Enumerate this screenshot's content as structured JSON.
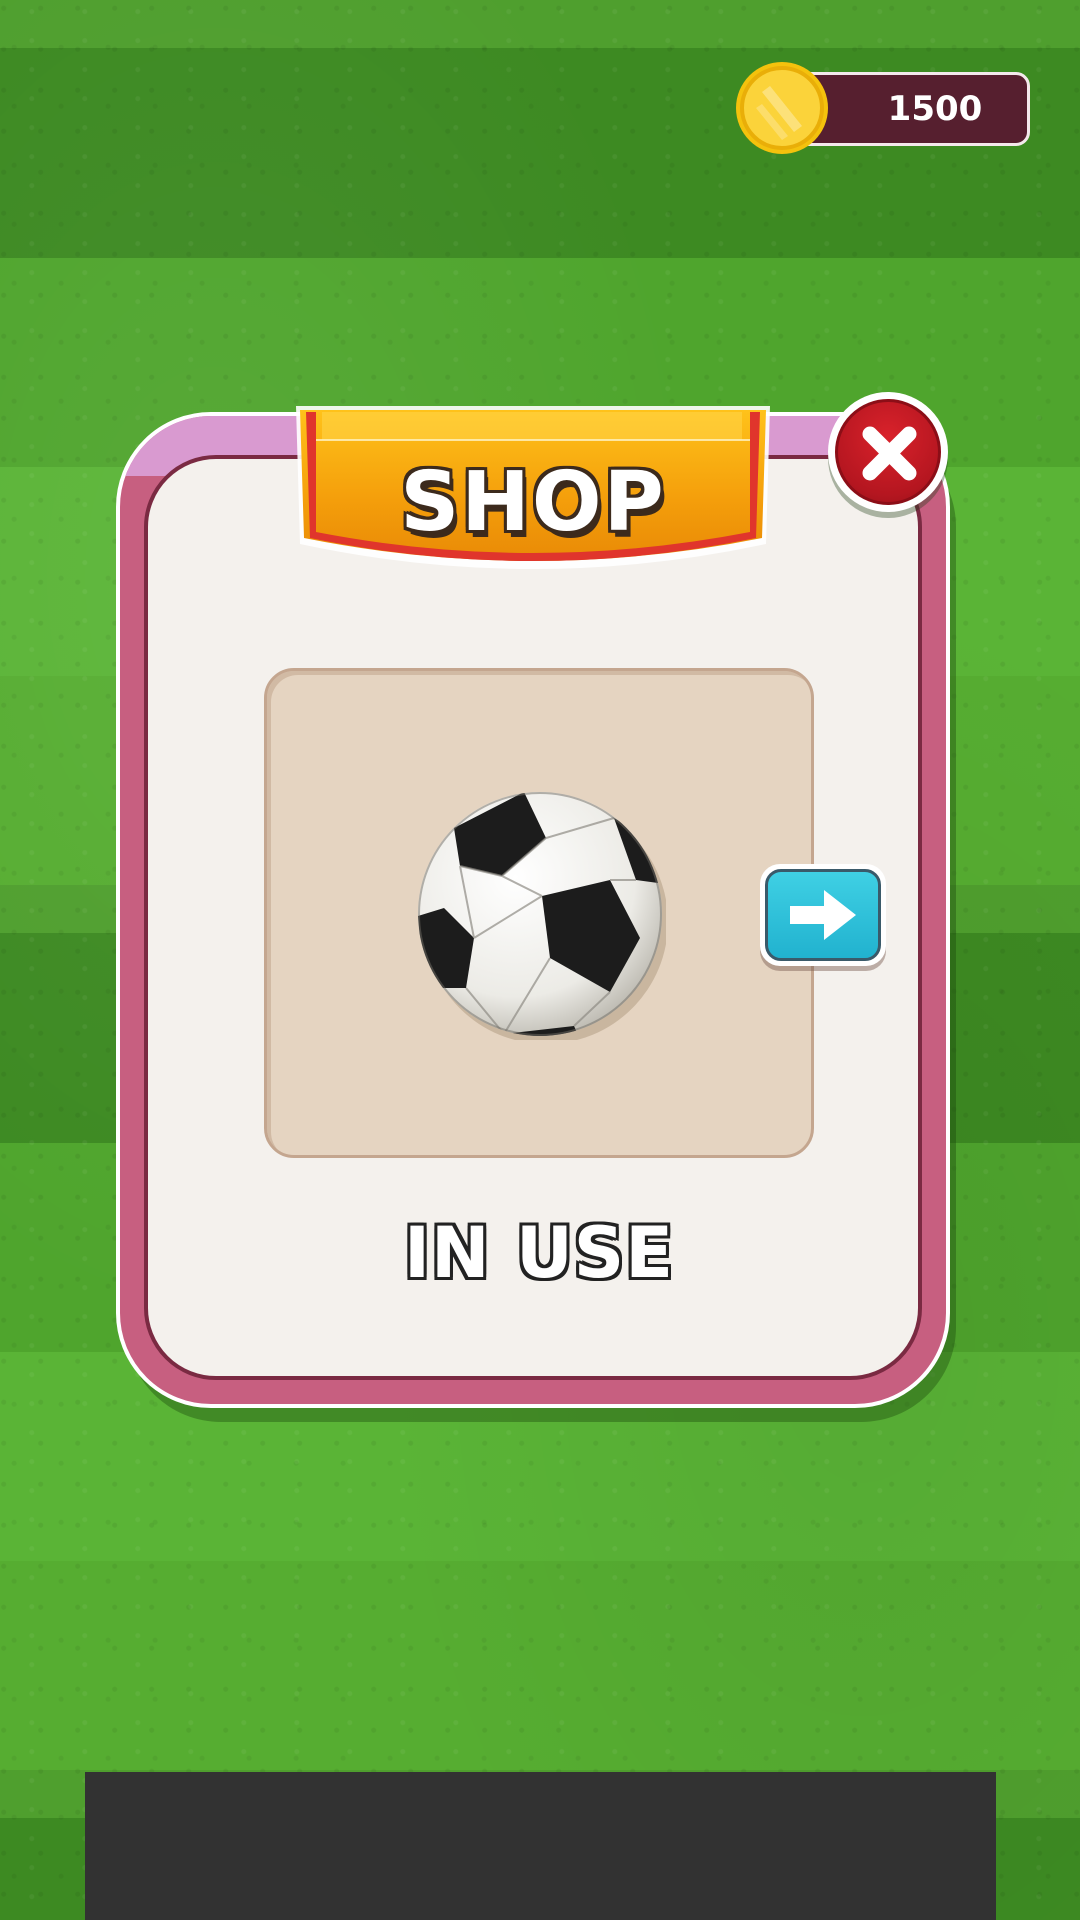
{
  "currency": {
    "coins": "1500",
    "icon": "gold-coin-icon"
  },
  "shop": {
    "title": "SHOP",
    "close_icon": "close-icon",
    "item": {
      "name": "soccer-ball",
      "status": "IN USE"
    },
    "next_icon": "arrow-right-icon"
  },
  "colors": {
    "panel_border": "#c75f80",
    "banner": "#f2a20c",
    "close_button": "#c8181f",
    "next_button": "#2bbcd6",
    "coin_bar": "#561f2f"
  }
}
